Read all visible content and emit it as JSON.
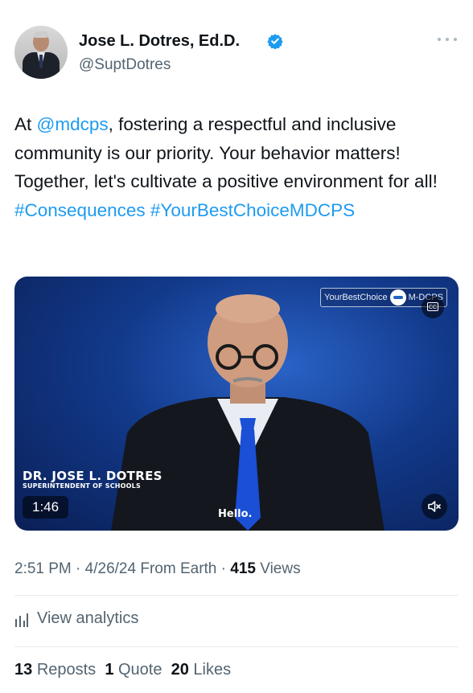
{
  "author": {
    "display_name": "Jose L. Dotres, Ed.D.",
    "handle": "@SuptDotres",
    "verified": true
  },
  "tweet": {
    "segments": [
      {
        "text": "At ",
        "type": "text"
      },
      {
        "text": "@mdcps",
        "type": "mention"
      },
      {
        "text": ", fostering a respectful and inclusive community is our priority. Your behavior matters! Together, let's cultivate a positive environment for all! ",
        "type": "text"
      },
      {
        "text": "#Consequences",
        "type": "hashtag"
      },
      {
        "text": " ",
        "type": "text"
      },
      {
        "text": "#YourBestChoiceMDCPS",
        "type": "hashtag"
      }
    ]
  },
  "video": {
    "badge_text": "YourBestChoice",
    "badge_brand": "M-DCPS",
    "cc_label": "CC",
    "lower_third_name": "DR. JOSE L. DOTRES",
    "lower_third_title": "SUPERINTENDENT OF SCHOOLS",
    "duration": "1:46",
    "caption": "Hello."
  },
  "meta": {
    "time": "2:51 PM",
    "date": "4/26/24",
    "source": "From Earth",
    "views_count": "415",
    "views_label": "Views"
  },
  "analytics": {
    "label": "View analytics"
  },
  "stats": {
    "reposts_count": "13",
    "reposts_label": "Reposts",
    "quotes_count": "1",
    "quotes_label": "Quote",
    "likes_count": "20",
    "likes_label": "Likes"
  },
  "colors": {
    "link": "#1d9bf0",
    "text": "#0f1419",
    "secondary": "#536471"
  }
}
